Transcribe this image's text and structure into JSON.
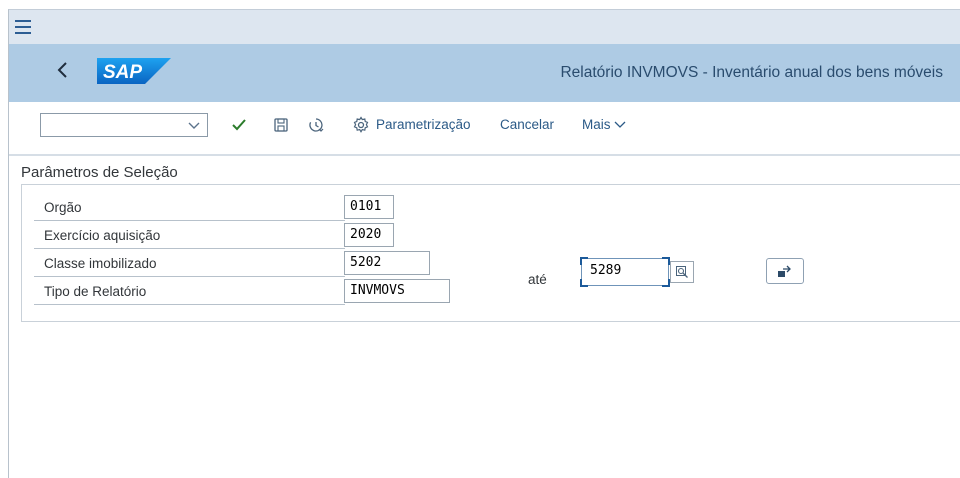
{
  "menubar": {
    "menu_icon": "hamburger-menu-icon"
  },
  "shell": {
    "back_icon": "chevron-left-icon",
    "logo_text": "SAP",
    "title": "Relatório INVMOVS  - Inventário anual dos bens móveis",
    "colors": {
      "shell_bg": "#aecbe4",
      "menu_bg": "#dde6f0",
      "logo_bg": "#1a7dd8"
    }
  },
  "toolbar": {
    "variant_value": "",
    "variant_icon": "chevron-down-icon",
    "execute_icon": "checkmark-icon",
    "save_icon": "save-icon",
    "history_icon": "history-icon",
    "settings_icon": "gear-icon",
    "parametrizacao_label": "Parametrização",
    "cancelar_label": "Cancelar",
    "mais_label": "Mais",
    "mais_icon": "chevron-down-icon"
  },
  "selection": {
    "group_title": "Parâmetros de Seleção",
    "fields": [
      {
        "label": "Orgão",
        "value": "0101"
      },
      {
        "label": "Exercício aquisição",
        "value": "2020"
      },
      {
        "label": "Classe imobilizado",
        "value": "5202"
      },
      {
        "label": "Tipo de Relatório",
        "value": "INVMOVS"
      }
    ],
    "range_label": "até",
    "range_to_value": "5289",
    "search_help_icon": "search-help-icon",
    "multiple_selection_icon": "multiple-selection-arrow-icon"
  }
}
